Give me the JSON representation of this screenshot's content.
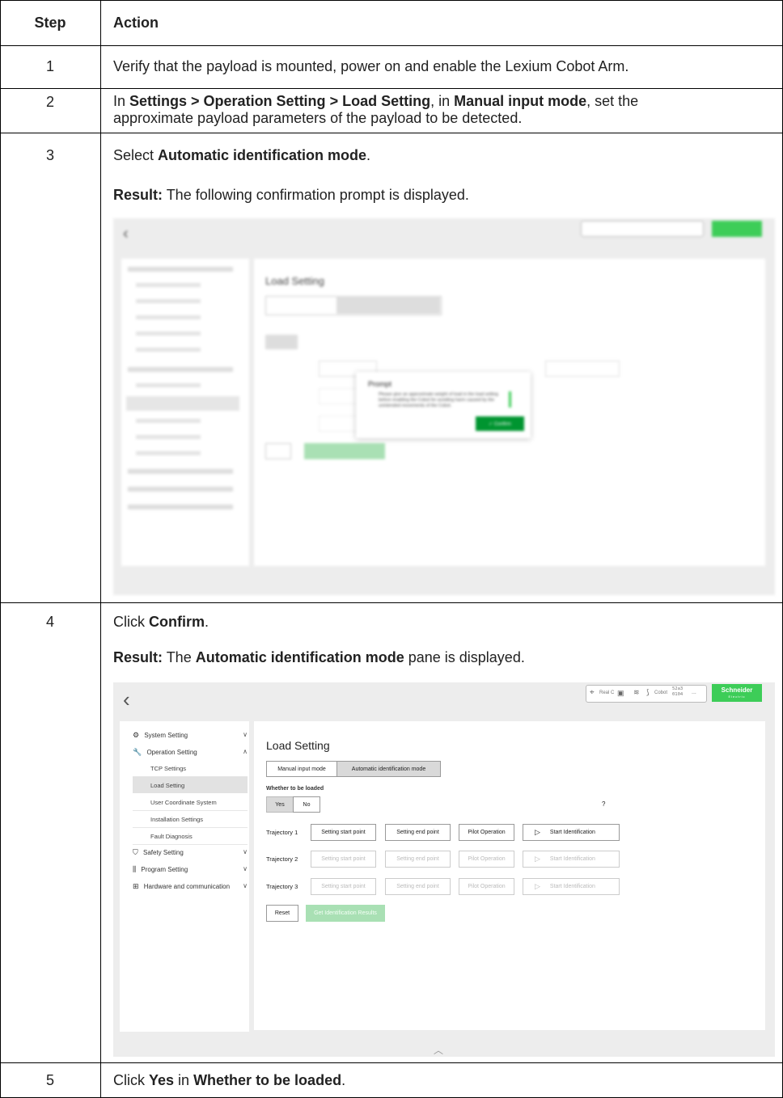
{
  "table": {
    "header": {
      "step": "Step",
      "action": "Action"
    },
    "rows": [
      {
        "step": "1",
        "text": "Verify that the payload is mounted, power on and enable the Lexium Cobot Arm."
      },
      {
        "step": "2",
        "t1": "In ",
        "b1": "Settings",
        "sep1": " > ",
        "b2": "Operation Setting",
        "sep2": " > ",
        "b3": "Load Setting",
        "t2": ", in ",
        "b4": "Manual input mode",
        "t3": ", set the",
        "line2": "approximate payload parameters of the payload to be detected."
      },
      {
        "step": "3",
        "t1": "Select ",
        "b1": "Automatic identification mode",
        "t2": ".",
        "result_label": "Result:",
        "result_text": " The following confirmation prompt is displayed."
      },
      {
        "step": "4",
        "t1": "Click ",
        "b1": "Confirm",
        "t2": ".",
        "result_label": "Result:",
        "r1": " The ",
        "rb": "Automatic identification mode",
        "r2": " pane is displayed."
      },
      {
        "step": "5",
        "t1": "Click ",
        "b1": "Yes",
        "t2": " in ",
        "b2": "Whether to be loaded",
        "t3": "."
      }
    ]
  },
  "prompt_screen": {
    "title": "Load Setting",
    "dialog": {
      "title": "Prompt",
      "message": "Please give an approximate weight of load in the load setting before enabling the Cobot for avoiding harm caused by the unintended movements of the Cobot.",
      "confirm_label": "✓ Confirm"
    }
  },
  "load_screen": {
    "topbar": {
      "status1": "Real C",
      "status2": "Cobot",
      "code_top": "52a3",
      "code_bottom": "0104",
      "more": "...",
      "brand": "Schneider",
      "brand_sub": "Electric"
    },
    "sidebar": [
      {
        "label": "System Setting",
        "icon": "gear-icon",
        "chev": "∨"
      },
      {
        "label": "Operation Setting",
        "icon": "wrench-icon",
        "chev": "∧"
      },
      {
        "label": "TCP Settings"
      },
      {
        "label": "Load Setting"
      },
      {
        "label": "User Coordinate System"
      },
      {
        "label": "Installation Settings"
      },
      {
        "label": "Fault Diagnosis"
      },
      {
        "label": "Safety Setting",
        "icon": "shield-icon",
        "chev": "∨"
      },
      {
        "label": "Program Setting",
        "icon": "sliders-icon",
        "chev": "∨"
      },
      {
        "label": "Hardware and communication",
        "icon": "network-icon",
        "chev": "∨"
      }
    ],
    "title": "Load Setting",
    "mode_tabs": [
      "Manual input mode",
      "Automatic identification mode"
    ],
    "loaded_label": "Whether to be loaded",
    "yes": "Yes",
    "no": "No",
    "help": "?",
    "trajectories": [
      "Trajectory 1",
      "Trajectory 2",
      "Trajectory 3"
    ],
    "buttons": {
      "start_point": "Setting start point",
      "end_point": "Setting end point",
      "pilot": "Pilot Operation",
      "start_id": "Start Identification",
      "reset": "Reset",
      "get_results": "Get Identification Results"
    }
  }
}
